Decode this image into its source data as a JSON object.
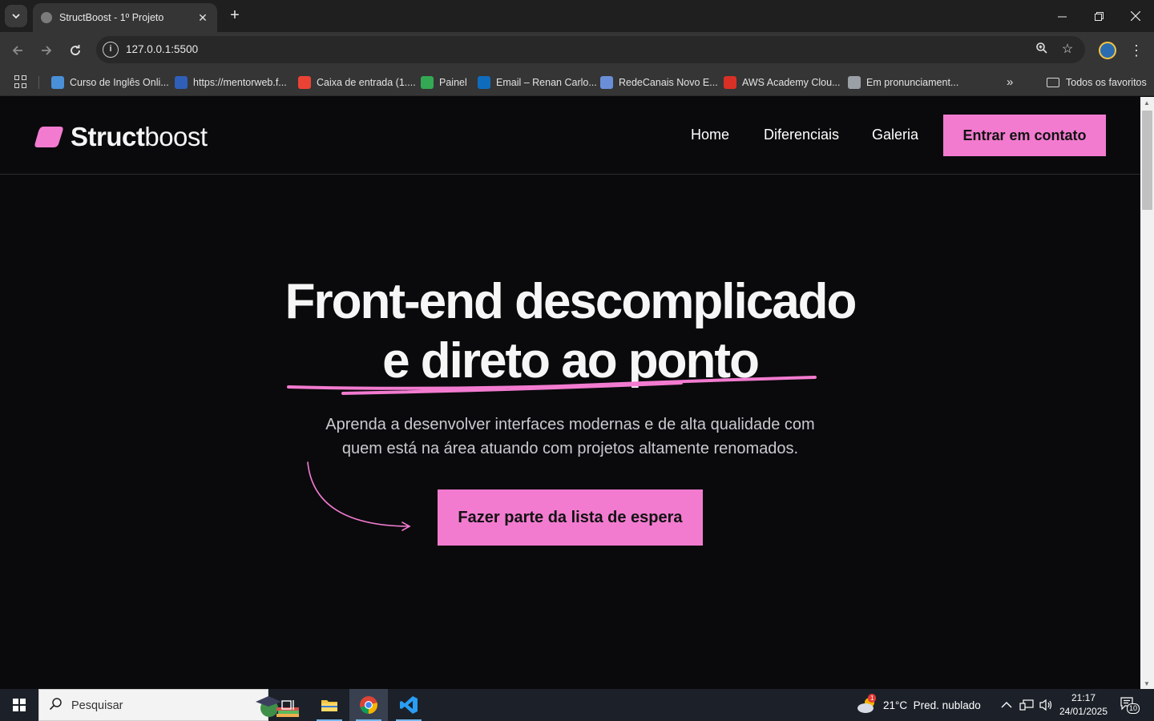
{
  "browser": {
    "tab_title": "StructBoost - 1º Projeto",
    "url": "127.0.0.1:5500",
    "bookmarks": [
      {
        "label": "Curso de Inglês Onli...",
        "color": "#4a90d9"
      },
      {
        "label": "https://mentorweb.f...",
        "color": "#2f5fb8"
      },
      {
        "label": "Caixa de entrada (1....",
        "color": "#ea4335"
      },
      {
        "label": "Painel",
        "color": "#34a853"
      },
      {
        "label": "Email – Renan Carlo...",
        "color": "#0f6cbd"
      },
      {
        "label": "RedeCanais Novo E...",
        "color": "#6a8fd8"
      },
      {
        "label": "AWS Academy Clou...",
        "color": "#d93025"
      },
      {
        "label": "Em pronunciament...",
        "color": "#9aa0a6"
      }
    ],
    "bookmarks_folder": "Todos os favoritos"
  },
  "site": {
    "logo": {
      "bold": "Struct",
      "light": "boost"
    },
    "nav": [
      "Home",
      "Diferenciais",
      "Galeria"
    ],
    "cta_top": "Entrar em contato",
    "hero": {
      "title_line1": "Front-end descomplicado",
      "title_line2": "e direto ao ponto",
      "subtitle_line1": "Aprenda a desenvolver interfaces modernas e de alta qualidade com",
      "subtitle_line2": "quem está na área atuando com projetos altamente renomados.",
      "cta": "Fazer parte da lista de espera"
    },
    "accent_color": "#f27bd0"
  },
  "taskbar": {
    "search_placeholder": "Pesquisar",
    "weather": "21°C  Pred. nublado",
    "weather_badge": "1",
    "time": "21:17",
    "date": "24/01/2025",
    "notifications": "10"
  }
}
